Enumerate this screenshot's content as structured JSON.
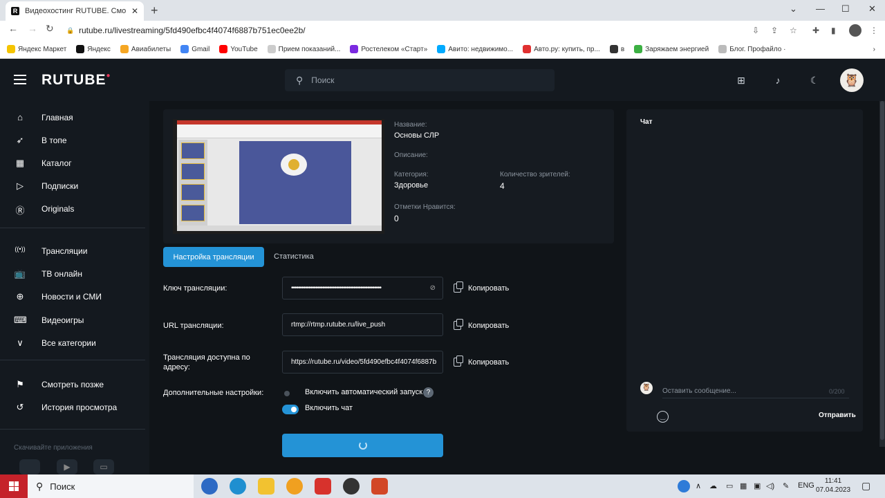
{
  "browser": {
    "tab_title": "Видеохостинг RUTUBE. Смотрит",
    "url": "rutube.ru/livestreaming/5fd490efbc4f4074f6887b751ec0ee2b/",
    "bookmarks": [
      {
        "label": "Яндекс Маркет",
        "color": "#f5c400"
      },
      {
        "label": "Яндекс",
        "color": "#111111"
      },
      {
        "label": "Авиабилеты",
        "color": "#f5a623"
      },
      {
        "label": "Gmail",
        "color": "#4285f4"
      },
      {
        "label": "YouTube",
        "color": "#ff0000"
      },
      {
        "label": "Прием показаний...",
        "color": "#cccccc"
      },
      {
        "label": "Ростелеком «Старт»",
        "color": "#7b2ae0"
      },
      {
        "label": "Авито: недвижимо...",
        "color": "#00aaff"
      },
      {
        "label": "Авто.ру: купить, пр...",
        "color": "#e03030"
      },
      {
        "label": "в",
        "color": "#333333"
      },
      {
        "label": "Заряжаем энергией",
        "color": "#3cb043"
      },
      {
        "label": "Блог. Профайло ·",
        "color": "#bbbbbb"
      }
    ]
  },
  "header": {
    "logo": "RUTUBE",
    "search_placeholder": "Поиск"
  },
  "sidebar": {
    "items": [
      {
        "label": "Главная",
        "icon": "home-icon",
        "glyph": "⌂"
      },
      {
        "label": "В топе",
        "icon": "rocket-icon",
        "glyph": "➶"
      },
      {
        "label": "Каталог",
        "icon": "grid-icon",
        "glyph": "▦"
      },
      {
        "label": "Подписки",
        "icon": "play-square-icon",
        "glyph": "▷"
      },
      {
        "label": "Originals",
        "icon": "originals-icon",
        "glyph": "Ⓡ"
      },
      {
        "label": "Трансляции",
        "icon": "broadcast-icon",
        "glyph": "((•))"
      },
      {
        "label": "ТВ онлайн",
        "icon": "tv-icon",
        "glyph": "📺"
      },
      {
        "label": "Новости и СМИ",
        "icon": "globe-icon",
        "glyph": "⊕"
      },
      {
        "label": "Видеоигры",
        "icon": "gamepad-icon",
        "glyph": "⌨"
      },
      {
        "label": "Все категории",
        "icon": "chevron-down-icon",
        "glyph": "∨"
      },
      {
        "label": "Смотреть позже",
        "icon": "bookmark-icon",
        "glyph": "⚑"
      },
      {
        "label": "История просмотра",
        "icon": "history-icon",
        "glyph": "↺"
      }
    ],
    "apps_label": "Скачивайте приложения"
  },
  "stream": {
    "name_label": "Название:",
    "name_value": "Основы СЛР",
    "description_label": "Описание:",
    "category_label": "Категория:",
    "category_value": "Здоровье",
    "viewers_label": "Количество зрителей:",
    "viewers_value": "4",
    "likes_label": "Отметки Нравится:",
    "likes_value": "0"
  },
  "tabs": {
    "settings": "Настройка трансляции",
    "stats": "Статистика"
  },
  "form": {
    "key_label": "Ключ трансляции:",
    "key_value": "••••••••••••••••••••••••••••••••••••••••••••••••••••",
    "url_label": "URL трансляции:",
    "url_value": "rtmp://rtmp.rutube.ru/live_push",
    "public_label": "Трансляция доступна по адресу:",
    "public_value": "https://rutube.ru/video/5fd490efbc4f4074f6887b",
    "copy_label": "Копировать",
    "extra_label": "Дополнительные настройки:",
    "autostart_label": "Включить автоматический запуск",
    "autostart_on": false,
    "chat_label": "Включить чат",
    "chat_on": true,
    "help_glyph": "?"
  },
  "chat": {
    "title": "Чат",
    "input_placeholder": "Оставить сообщение...",
    "counter": "0/200",
    "send_label": "Отправить"
  },
  "taskbar": {
    "search_label": "Поиск",
    "lang": "ENG",
    "time": "11:41",
    "date": "07.04.2023"
  },
  "colors": {
    "accent": "#2493d6",
    "bg": "#14191f"
  }
}
